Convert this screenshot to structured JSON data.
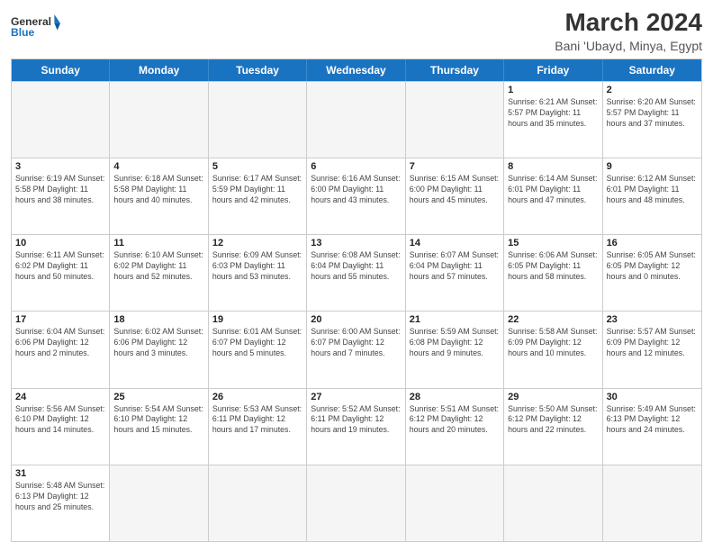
{
  "header": {
    "logo_general": "General",
    "logo_blue": "Blue",
    "title": "March 2024",
    "subtitle": "Bani 'Ubayd, Minya, Egypt"
  },
  "weekdays": [
    "Sunday",
    "Monday",
    "Tuesday",
    "Wednesday",
    "Thursday",
    "Friday",
    "Saturday"
  ],
  "rows": [
    [
      {
        "day": "",
        "info": ""
      },
      {
        "day": "",
        "info": ""
      },
      {
        "day": "",
        "info": ""
      },
      {
        "day": "",
        "info": ""
      },
      {
        "day": "",
        "info": ""
      },
      {
        "day": "1",
        "info": "Sunrise: 6:21 AM\nSunset: 5:57 PM\nDaylight: 11 hours\nand 35 minutes."
      },
      {
        "day": "2",
        "info": "Sunrise: 6:20 AM\nSunset: 5:57 PM\nDaylight: 11 hours\nand 37 minutes."
      }
    ],
    [
      {
        "day": "3",
        "info": "Sunrise: 6:19 AM\nSunset: 5:58 PM\nDaylight: 11 hours\nand 38 minutes."
      },
      {
        "day": "4",
        "info": "Sunrise: 6:18 AM\nSunset: 5:58 PM\nDaylight: 11 hours\nand 40 minutes."
      },
      {
        "day": "5",
        "info": "Sunrise: 6:17 AM\nSunset: 5:59 PM\nDaylight: 11 hours\nand 42 minutes."
      },
      {
        "day": "6",
        "info": "Sunrise: 6:16 AM\nSunset: 6:00 PM\nDaylight: 11 hours\nand 43 minutes."
      },
      {
        "day": "7",
        "info": "Sunrise: 6:15 AM\nSunset: 6:00 PM\nDaylight: 11 hours\nand 45 minutes."
      },
      {
        "day": "8",
        "info": "Sunrise: 6:14 AM\nSunset: 6:01 PM\nDaylight: 11 hours\nand 47 minutes."
      },
      {
        "day": "9",
        "info": "Sunrise: 6:12 AM\nSunset: 6:01 PM\nDaylight: 11 hours\nand 48 minutes."
      }
    ],
    [
      {
        "day": "10",
        "info": "Sunrise: 6:11 AM\nSunset: 6:02 PM\nDaylight: 11 hours\nand 50 minutes."
      },
      {
        "day": "11",
        "info": "Sunrise: 6:10 AM\nSunset: 6:02 PM\nDaylight: 11 hours\nand 52 minutes."
      },
      {
        "day": "12",
        "info": "Sunrise: 6:09 AM\nSunset: 6:03 PM\nDaylight: 11 hours\nand 53 minutes."
      },
      {
        "day": "13",
        "info": "Sunrise: 6:08 AM\nSunset: 6:04 PM\nDaylight: 11 hours\nand 55 minutes."
      },
      {
        "day": "14",
        "info": "Sunrise: 6:07 AM\nSunset: 6:04 PM\nDaylight: 11 hours\nand 57 minutes."
      },
      {
        "day": "15",
        "info": "Sunrise: 6:06 AM\nSunset: 6:05 PM\nDaylight: 11 hours\nand 58 minutes."
      },
      {
        "day": "16",
        "info": "Sunrise: 6:05 AM\nSunset: 6:05 PM\nDaylight: 12 hours\nand 0 minutes."
      }
    ],
    [
      {
        "day": "17",
        "info": "Sunrise: 6:04 AM\nSunset: 6:06 PM\nDaylight: 12 hours\nand 2 minutes."
      },
      {
        "day": "18",
        "info": "Sunrise: 6:02 AM\nSunset: 6:06 PM\nDaylight: 12 hours\nand 3 minutes."
      },
      {
        "day": "19",
        "info": "Sunrise: 6:01 AM\nSunset: 6:07 PM\nDaylight: 12 hours\nand 5 minutes."
      },
      {
        "day": "20",
        "info": "Sunrise: 6:00 AM\nSunset: 6:07 PM\nDaylight: 12 hours\nand 7 minutes."
      },
      {
        "day": "21",
        "info": "Sunrise: 5:59 AM\nSunset: 6:08 PM\nDaylight: 12 hours\nand 9 minutes."
      },
      {
        "day": "22",
        "info": "Sunrise: 5:58 AM\nSunset: 6:09 PM\nDaylight: 12 hours\nand 10 minutes."
      },
      {
        "day": "23",
        "info": "Sunrise: 5:57 AM\nSunset: 6:09 PM\nDaylight: 12 hours\nand 12 minutes."
      }
    ],
    [
      {
        "day": "24",
        "info": "Sunrise: 5:56 AM\nSunset: 6:10 PM\nDaylight: 12 hours\nand 14 minutes."
      },
      {
        "day": "25",
        "info": "Sunrise: 5:54 AM\nSunset: 6:10 PM\nDaylight: 12 hours\nand 15 minutes."
      },
      {
        "day": "26",
        "info": "Sunrise: 5:53 AM\nSunset: 6:11 PM\nDaylight: 12 hours\nand 17 minutes."
      },
      {
        "day": "27",
        "info": "Sunrise: 5:52 AM\nSunset: 6:11 PM\nDaylight: 12 hours\nand 19 minutes."
      },
      {
        "day": "28",
        "info": "Sunrise: 5:51 AM\nSunset: 6:12 PM\nDaylight: 12 hours\nand 20 minutes."
      },
      {
        "day": "29",
        "info": "Sunrise: 5:50 AM\nSunset: 6:12 PM\nDaylight: 12 hours\nand 22 minutes."
      },
      {
        "day": "30",
        "info": "Sunrise: 5:49 AM\nSunset: 6:13 PM\nDaylight: 12 hours\nand 24 minutes."
      }
    ],
    [
      {
        "day": "31",
        "info": "Sunrise: 5:48 AM\nSunset: 6:13 PM\nDaylight: 12 hours\nand 25 minutes."
      },
      {
        "day": "",
        "info": ""
      },
      {
        "day": "",
        "info": ""
      },
      {
        "day": "",
        "info": ""
      },
      {
        "day": "",
        "info": ""
      },
      {
        "day": "",
        "info": ""
      },
      {
        "day": "",
        "info": ""
      }
    ]
  ]
}
